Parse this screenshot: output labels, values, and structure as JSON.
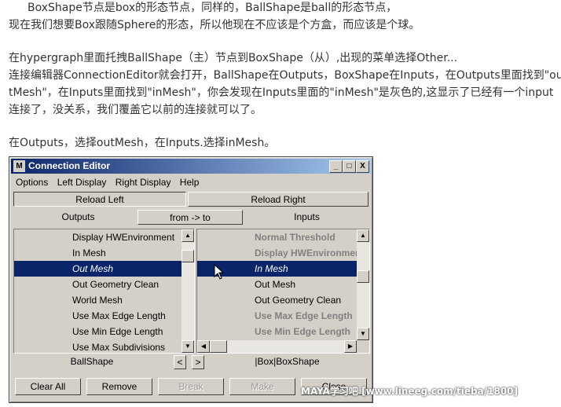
{
  "article": {
    "lines": [
      "BoxShape节点是box的形态节点，同样的，BallShape是ball的形态节点，",
      "现在我们想要Box跟随Sphere的形态，所以他现在不应该是个方盒，而应该是个球。",
      "在hypergraph里面托拽BallShape（主）节点到BoxShape（从）,出现的菜单选择Other...",
      "连接编辑器ConnectionEditor就会打开，BallShape在Outputs，BoxShape在Inputs，在Outputs里面找到\"ou",
      "tMesh\"，在Inputs里面找到\"inMesh\"，你会发现在Inputs里面的\"inMesh\"是灰色的,这显示了已经有一个input",
      "连接了，没关系，我们覆盖它以前的连接就可以了。",
      "在Outputs，选择outMesh，在Inputs.选择inMesh。"
    ]
  },
  "window": {
    "title": "Connection Editor",
    "logo": "M",
    "minimize": "_",
    "maximize": "□",
    "close": "X"
  },
  "menu": [
    "Options",
    "Left Display",
    "Right Display",
    "Help"
  ],
  "buttons": {
    "reload_left": "Reload Left",
    "reload_right": "Reload Right",
    "direction": "from -> to",
    "clear_all": "Clear All",
    "remove": "Remove",
    "break": "Break",
    "make": "Make",
    "close": "Close"
  },
  "labels": {
    "outputs": "Outputs",
    "inputs": "Inputs",
    "left_node": "BallShape",
    "right_node": "|Box|BoxShape",
    "nav_prev": "<",
    "nav_next": ">"
  },
  "left_list": [
    {
      "text": "Display HWEnvironment",
      "state": "normal"
    },
    {
      "text": "In Mesh",
      "state": "normal"
    },
    {
      "text": "Out Mesh",
      "state": "selected"
    },
    {
      "text": "Out Geometry Clean",
      "state": "normal"
    },
    {
      "text": "World Mesh",
      "state": "normal"
    },
    {
      "text": "Use Max Edge Length",
      "state": "normal"
    },
    {
      "text": "Use Min Edge Length",
      "state": "normal"
    },
    {
      "text": "Use Max Subdivisions",
      "state": "normal"
    }
  ],
  "right_list": [
    {
      "text": "Normal Threshold",
      "state": "dim"
    },
    {
      "text": "Display HWEnvironment",
      "state": "dim"
    },
    {
      "text": "In Mesh",
      "state": "selected"
    },
    {
      "text": "Out Mesh",
      "state": "normal"
    },
    {
      "text": "Out Geometry Clean",
      "state": "normal"
    },
    {
      "text": "Use Max Edge Length",
      "state": "dim"
    },
    {
      "text": "Use Min Edge Length",
      "state": "dim"
    }
  ],
  "watermark": "MAYA学习吧 [www.lineeg.com/tieba/1800]"
}
